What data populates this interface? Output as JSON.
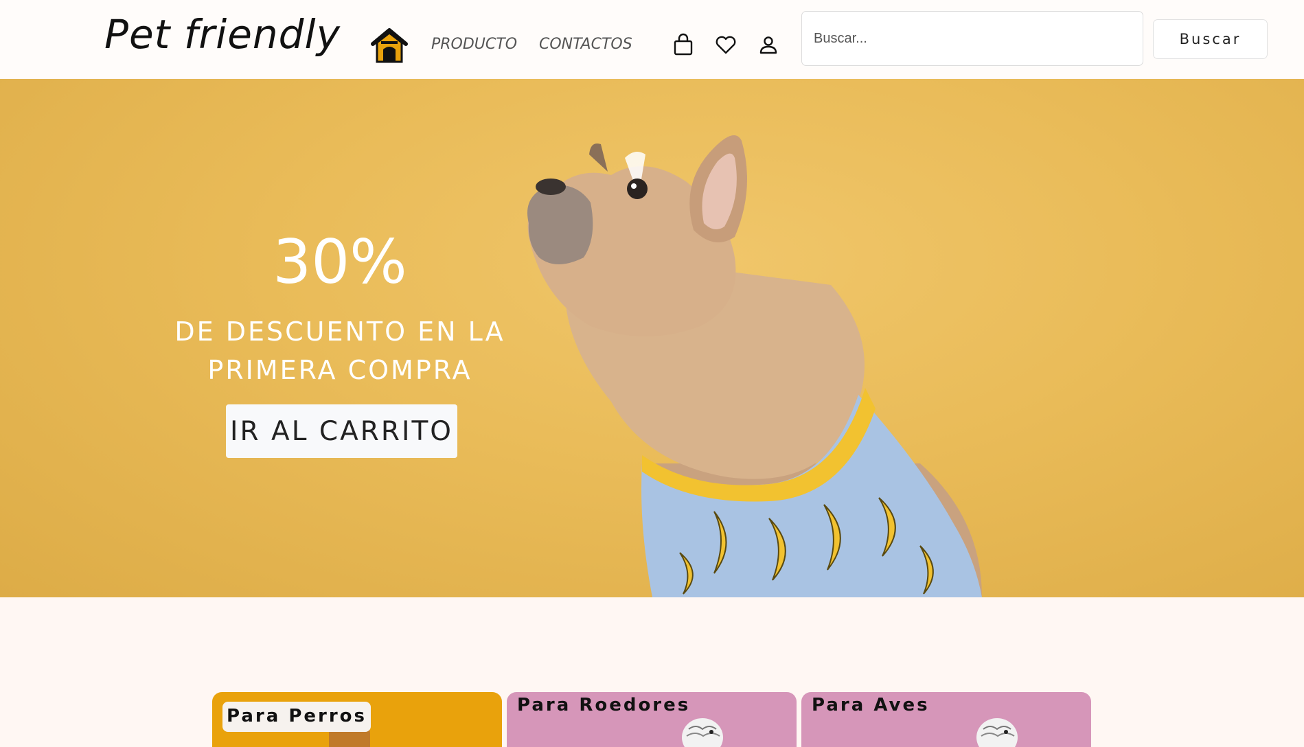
{
  "header": {
    "brand": "Pet friendly",
    "nav": {
      "producto": "PRODUCTO",
      "contactos": "CONTACTOS"
    },
    "icons": [
      "home-icon",
      "shopping-bag-icon",
      "heart-icon",
      "user-icon"
    ],
    "search": {
      "placeholder": "Buscar...",
      "value": "",
      "button_label": "Buscar"
    }
  },
  "hero": {
    "discount": "30%",
    "subtitle_line1": "DE DESCUENTO EN LA",
    "subtitle_line2": "PRIMERA COMPRA",
    "cta_label": "IR AL CARRITO"
  },
  "categories": [
    {
      "label": "Para Perros"
    },
    {
      "label": "Para Roedores"
    },
    {
      "label": "Para Aves"
    }
  ],
  "colors": {
    "hero_bg": "#e9bb58",
    "cat_perros": "#e9a20c",
    "cat_roedores": "#d696b9",
    "cat_aves": "#d696b9",
    "page_bg": "#fff7f3"
  }
}
